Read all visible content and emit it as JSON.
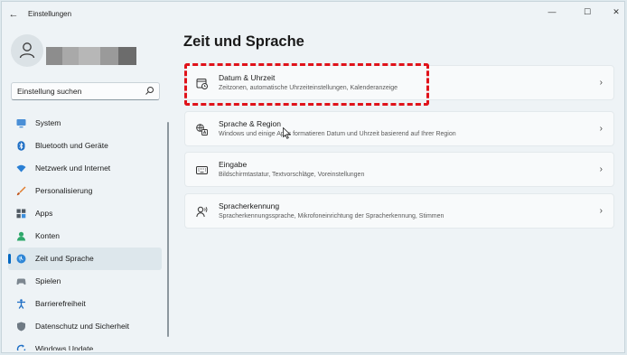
{
  "window": {
    "app_title": "Einstellungen",
    "back_icon": "back-arrow-icon",
    "controls": {
      "minimize": "—",
      "maximize": "☐",
      "close": "✕"
    }
  },
  "account": {
    "avatar_icon": "person-icon",
    "name_redacted_colors": [
      "#8d8d8d",
      "#a9a9a9",
      "#b7b7b7",
      "#9a9a9a",
      "#6c6c6c",
      "#5f6466"
    ]
  },
  "search": {
    "placeholder": "Einstellung suchen",
    "icon": "search-icon"
  },
  "sidebar": {
    "items": [
      {
        "label": "System",
        "icon": "system-icon"
      },
      {
        "label": "Bluetooth und Geräte",
        "icon": "bluetooth-icon"
      },
      {
        "label": "Netzwerk und Internet",
        "icon": "network-icon"
      },
      {
        "label": "Personalisierung",
        "icon": "brush-icon"
      },
      {
        "label": "Apps",
        "icon": "apps-icon"
      },
      {
        "label": "Konten",
        "icon": "account-icon"
      },
      {
        "label": "Zeit und Sprache",
        "icon": "globe-clock-icon",
        "active": true
      },
      {
        "label": "Spielen",
        "icon": "gamepad-icon"
      },
      {
        "label": "Barrierefreiheit",
        "icon": "accessibility-icon"
      },
      {
        "label": "Datenschutz und Sicherheit",
        "icon": "shield-icon"
      },
      {
        "label": "Windows Update",
        "icon": "update-icon"
      }
    ]
  },
  "main": {
    "title": "Zeit und Sprache",
    "cards": [
      {
        "title": "Datum & Uhrzeit",
        "desc": "Zeitzonen, automatische Uhrzeiteinstellungen, Kalenderanzeige",
        "icon": "calendar-clock-icon",
        "highlighted": true
      },
      {
        "title": "Sprache & Region",
        "desc": "Windows und einige Apps formatieren Datum und Uhrzeit basierend auf Ihrer Region",
        "icon": "language-icon"
      },
      {
        "title": "Eingabe",
        "desc": "Bildschirmtastatur, Textvorschläge, Voreinstellungen",
        "icon": "keyboard-icon"
      },
      {
        "title": "Spracherkennung",
        "desc": "Spracherkennungssprache, Mikrofoneinrichtung der Spracherkennung, Stimmen",
        "icon": "speech-icon"
      }
    ],
    "chevron": "›"
  },
  "colors": {
    "accent": "#0067c0",
    "highlight": "#e0121a"
  }
}
